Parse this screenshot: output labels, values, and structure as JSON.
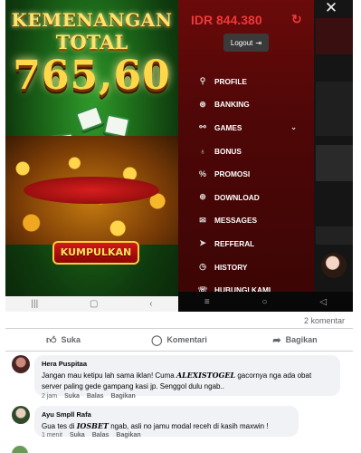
{
  "left_screen": {
    "title_line1": "KEMENANGAN",
    "title_line2": "TOTAL",
    "amount": "765,60",
    "collect_button": "KUMPULKAN",
    "nav_icons": [
      "menu-icon",
      "home-square-icon",
      "back-icon"
    ]
  },
  "right_screen": {
    "balance": "IDR 844.380",
    "logout_label": "Logout",
    "menu": [
      {
        "label": "PROFILE",
        "icon": "pin-icon"
      },
      {
        "label": "BANKING",
        "icon": "bank-icon"
      },
      {
        "label": "GAMES",
        "icon": "gamepad-icon",
        "has_chevron": true
      },
      {
        "label": "BONUS",
        "icon": "bulb-icon"
      },
      {
        "label": "PROMOSI",
        "icon": "percent-icon"
      },
      {
        "label": "DOWNLOAD",
        "icon": "download-icon"
      },
      {
        "label": "MESSAGES",
        "icon": "mail-icon"
      },
      {
        "label": "REFFERAL",
        "icon": "send-icon"
      },
      {
        "label": "HISTORY",
        "icon": "clock-icon"
      },
      {
        "label": "HUBUNGI KAMI",
        "icon": "chat-icon"
      }
    ]
  },
  "post": {
    "comment_count": "2 komentar",
    "actions": {
      "like": "Suka",
      "comment": "Komentari",
      "share": "Bagikan"
    }
  },
  "comments": [
    {
      "name": "Hera Puspitaa",
      "text_before": "Jangan mau ketipu lah sama iklan! Cuma ",
      "highlight": "ALEXISTOGEL",
      "text_after": " gacornya nga ada obat server paling gede gampang kasi jp. Senggol dulu ngab..",
      "time": "2 jam",
      "like": "Suka",
      "reply": "Balas",
      "share": "Bagikan"
    },
    {
      "name": "Ayu Smpll Rafa",
      "text_before": "Gua tes di ",
      "highlight": "IOSBET",
      "text_after": " ngab, asli no jamu modal receh di kasih maxwin !",
      "time": "1 menit",
      "like": "Suka",
      "reply": "Balas",
      "share": "Bagikan"
    }
  ],
  "colors": {
    "menu_bg": "#5a0808",
    "balance": "#f03838",
    "fb_gray": "#65676b",
    "bubble": "#f0f2f5"
  }
}
